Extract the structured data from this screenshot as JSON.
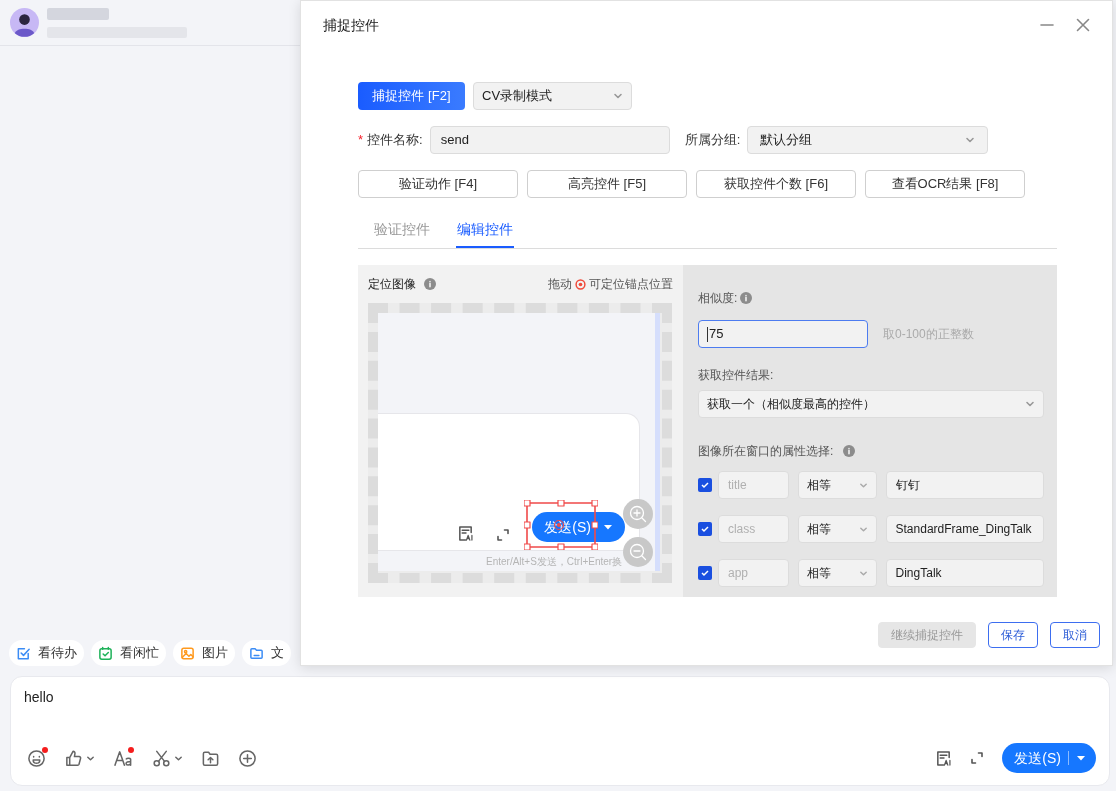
{
  "chat": {
    "quick_actions": [
      {
        "label": "看待办",
        "kind": "todo"
      },
      {
        "label": "看闲忙",
        "kind": "calendar"
      },
      {
        "label": "图片",
        "kind": "image"
      },
      {
        "label": "文",
        "kind": "folder"
      }
    ],
    "message_input": {
      "value": "hello"
    },
    "toolbar": [
      {
        "kind": "emoji",
        "badge": true,
        "menu": false
      },
      {
        "kind": "thumb",
        "badge": false,
        "menu": true
      },
      {
        "kind": "font",
        "badge": true,
        "menu": false
      },
      {
        "kind": "scissors",
        "badge": false,
        "menu": true
      },
      {
        "kind": "upload",
        "badge": false,
        "menu": false
      },
      {
        "kind": "plus",
        "badge": false,
        "menu": false
      }
    ],
    "send_button": "发送(S)"
  },
  "dialog": {
    "title": "捕捉控件",
    "capture_button": "捕捉控件 [F2]",
    "mode_select": "CV录制模式",
    "required_mark": "*",
    "name_label": "控件名称:",
    "name_value": "send",
    "group_label": "所属分组:",
    "group_value": "默认分组",
    "actions": [
      "验证动作 [F4]",
      "高亮控件 [F5]",
      "获取控件个数 [F6]",
      "查看OCR结果 [F8]"
    ],
    "tabs": [
      {
        "label": "验证控件",
        "selected": false
      },
      {
        "label": "编辑控件",
        "selected": true
      }
    ],
    "image_panel": {
      "title": "定位图像",
      "hint_prefix": "拖动",
      "hint_suffix": "可定位锚点位置",
      "preview": {
        "send_button": "发送(S)",
        "shortcut_hint": "Enter/Alt+S发送，Ctrl+Enter换"
      }
    },
    "settings": {
      "similarity_label": "相似度:",
      "similarity_value": "75",
      "similarity_hint": "取0-100的正整数",
      "result_label": "获取控件结果:",
      "result_value": "获取一个（相似度最高的控件）",
      "attributes_label": "图像所在窗口的属性选择:",
      "attributes": [
        {
          "key": "title",
          "checked": true,
          "operator": "相等",
          "value": "钉钉"
        },
        {
          "key": "class",
          "checked": true,
          "operator": "相等",
          "value": "StandardFrame_DingTalk"
        },
        {
          "key": "app",
          "checked": true,
          "operator": "相等",
          "value": "DingTalk"
        }
      ]
    },
    "footer": [
      {
        "label": "继续捕捉控件",
        "disabled": true
      },
      {
        "label": "保存",
        "disabled": false
      },
      {
        "label": "取消",
        "disabled": false
      }
    ]
  }
}
